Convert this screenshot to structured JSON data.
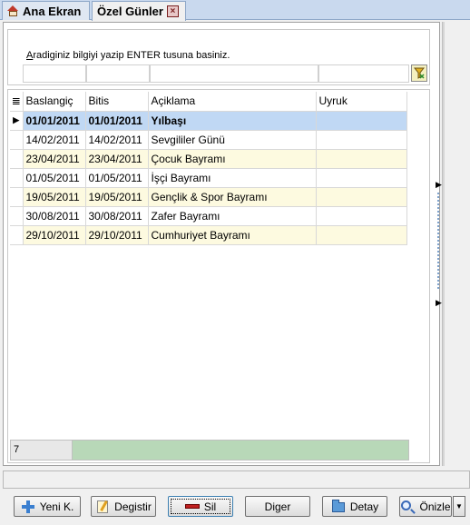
{
  "tabs": [
    {
      "label": "Ana Ekran"
    },
    {
      "label": "Özel Günler"
    }
  ],
  "filter": {
    "hint_prefix": "A",
    "hint_rest": "radiginiz bilgiyi yazip ENTER tusuna basiniz."
  },
  "grid": {
    "columns": [
      "Baslangiç",
      "Bitis",
      "Açiklama",
      "Uyruk"
    ],
    "rows": [
      {
        "start": "01/01/2011",
        "end": "01/01/2011",
        "desc": "Yılbaşı",
        "uyruk": ""
      },
      {
        "start": "14/02/2011",
        "end": "14/02/2011",
        "desc": "Sevgililer Günü",
        "uyruk": ""
      },
      {
        "start": "23/04/2011",
        "end": "23/04/2011",
        "desc": "Çocuk Bayramı",
        "uyruk": ""
      },
      {
        "start": "01/05/2011",
        "end": "01/05/2011",
        "desc": "İşçi Bayramı",
        "uyruk": ""
      },
      {
        "start": "19/05/2011",
        "end": "19/05/2011",
        "desc": "Gençlik & Spor Bayramı",
        "uyruk": ""
      },
      {
        "start": "30/08/2011",
        "end": "30/08/2011",
        "desc": "Zafer Bayramı",
        "uyruk": ""
      },
      {
        "start": "29/10/2011",
        "end": "29/10/2011",
        "desc": "Cumhuriyet Bayramı",
        "uyruk": ""
      }
    ],
    "selected_row": 0,
    "record_count": "7"
  },
  "buttons": {
    "new": "Yeni K.",
    "edit": "Degistir",
    "delete": "Sil",
    "other": "Diger",
    "detail": "Detay",
    "preview": "Önizle"
  },
  "colors": {
    "selected_row": "#c0d8f4",
    "alt_row": "#fdfae0",
    "footer_green": "#b8d8b8"
  }
}
